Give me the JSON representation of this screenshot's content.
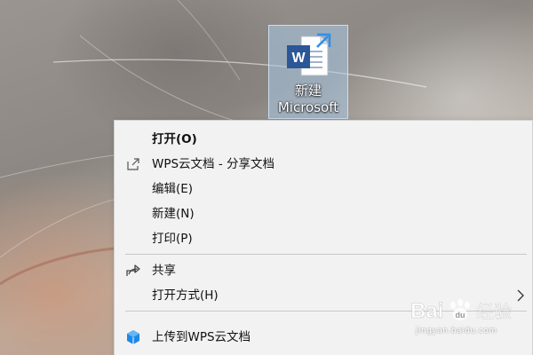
{
  "desktop": {
    "file_icon": {
      "label_line1": "新建",
      "label_line2": "Microsoft"
    }
  },
  "context_menu": {
    "items": [
      {
        "label": "打开(O)",
        "icon": "",
        "bold": true
      },
      {
        "label": "WPS云文档 - 分享文档",
        "icon": "share-out-icon"
      },
      {
        "label": "编辑(E)",
        "icon": ""
      },
      {
        "label": "新建(N)",
        "icon": ""
      },
      {
        "label": "打印(P)",
        "icon": ""
      },
      {
        "label": "共享",
        "icon": "share-icon"
      },
      {
        "label": "打开方式(H)",
        "icon": "",
        "has_submenu": true
      },
      {
        "label": "上传到WPS云文档",
        "icon": "wps-cloud-icon"
      }
    ]
  },
  "watermark": {
    "brand": "Bai",
    "brand_suffix": "经验",
    "url": "jingyan.baidu.com"
  },
  "colors": {
    "word_blue": "#2b5797",
    "menu_background": "#f2f2f2",
    "wps_cloud_blue": "#1e88e5"
  }
}
